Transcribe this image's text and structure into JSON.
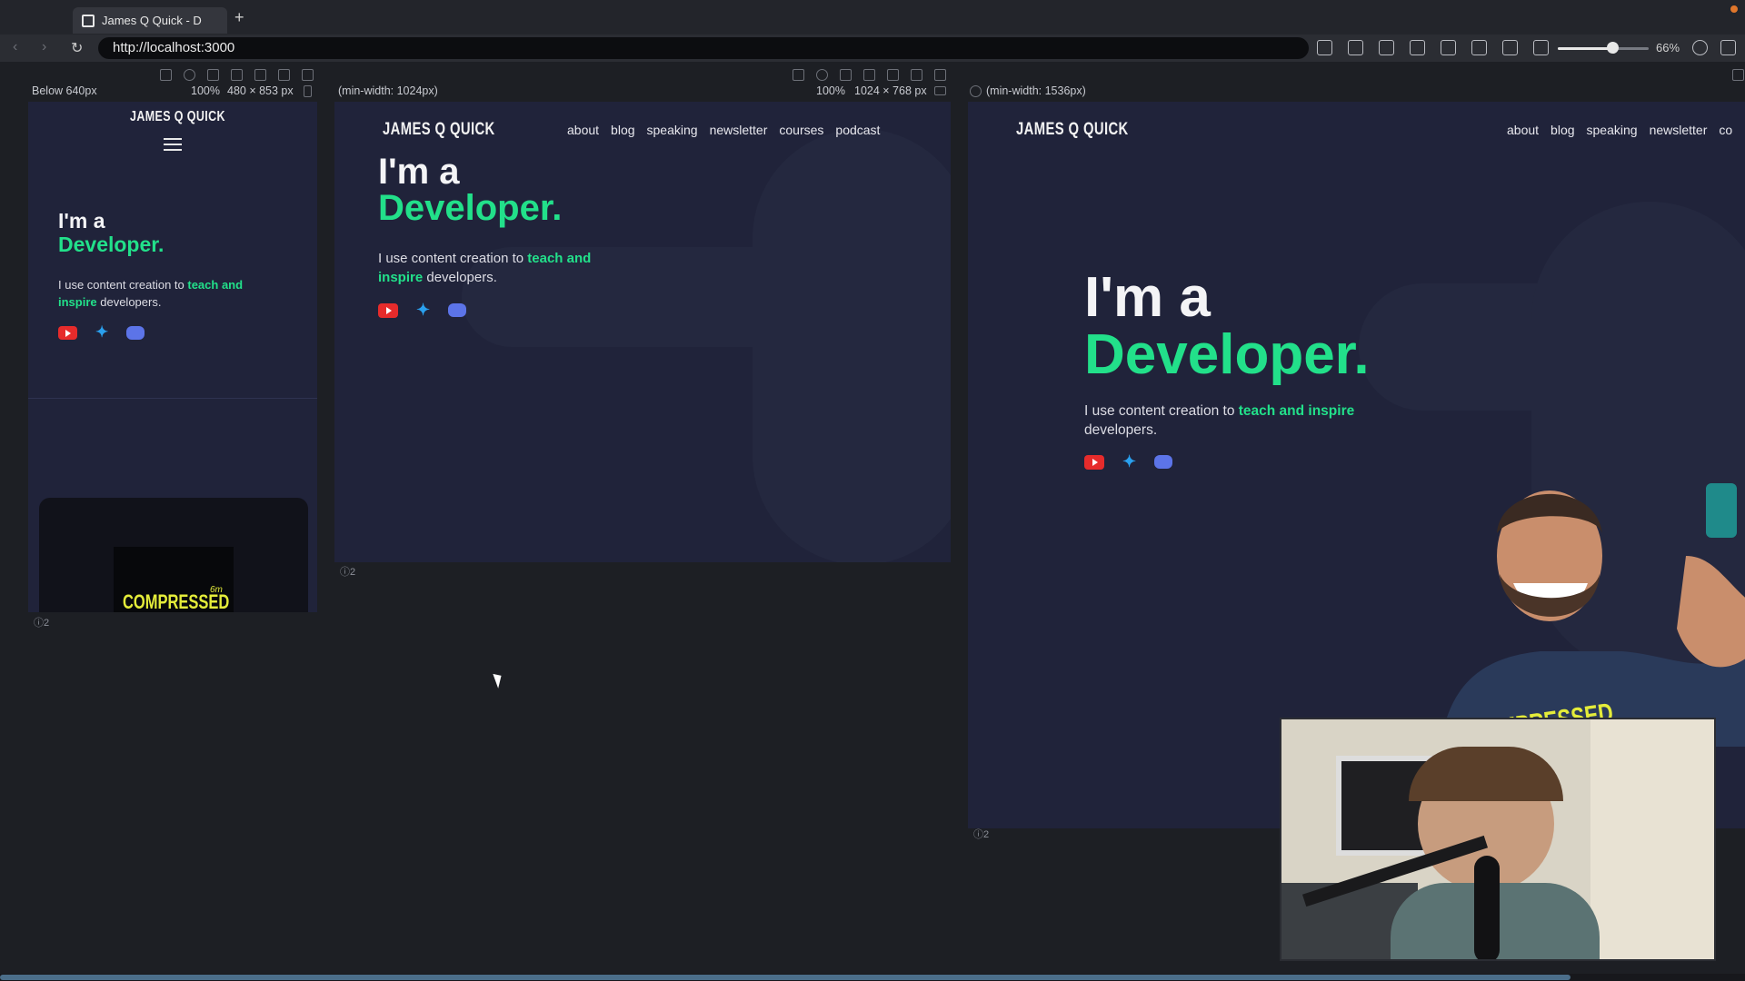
{
  "browser": {
    "tab_title": "James Q Quick - D",
    "new_tab": "+",
    "url": "http://localhost:3000",
    "zoom": "66%",
    "zoom_level": 0.66
  },
  "viewports": {
    "small": {
      "label": "Below 640px",
      "scale": "100%",
      "size": "480 × 853 px",
      "badge": "2"
    },
    "medium": {
      "label": "(min-width: 1024px)",
      "scale": "100%",
      "size": "1024 × 768 px",
      "badge": "2"
    },
    "large": {
      "label": "(min-width: 1536px)",
      "badge": "2"
    }
  },
  "site": {
    "logo": "JAMES Q QUICK",
    "nav": [
      "about",
      "blog",
      "speaking",
      "newsletter",
      "courses",
      "podcast"
    ],
    "nav_large_partial": "co",
    "hero_line1": "I'm a",
    "hero_line2": "Developer.",
    "hero_text_pre": "I use content creation to ",
    "hero_text_highlight": "teach and inspire",
    "hero_text_post": " developers.",
    "hero_text_highlight_a": "teach and",
    "hero_text_highlight_b": "inspire",
    "card_text": "COMPRESSED",
    "card_sup": "6m",
    "accent": "#22e08a",
    "bg": "#20233a"
  },
  "icons": [
    "youtube-icon",
    "twitter-icon",
    "discord-icon",
    "hamburger-icon"
  ]
}
